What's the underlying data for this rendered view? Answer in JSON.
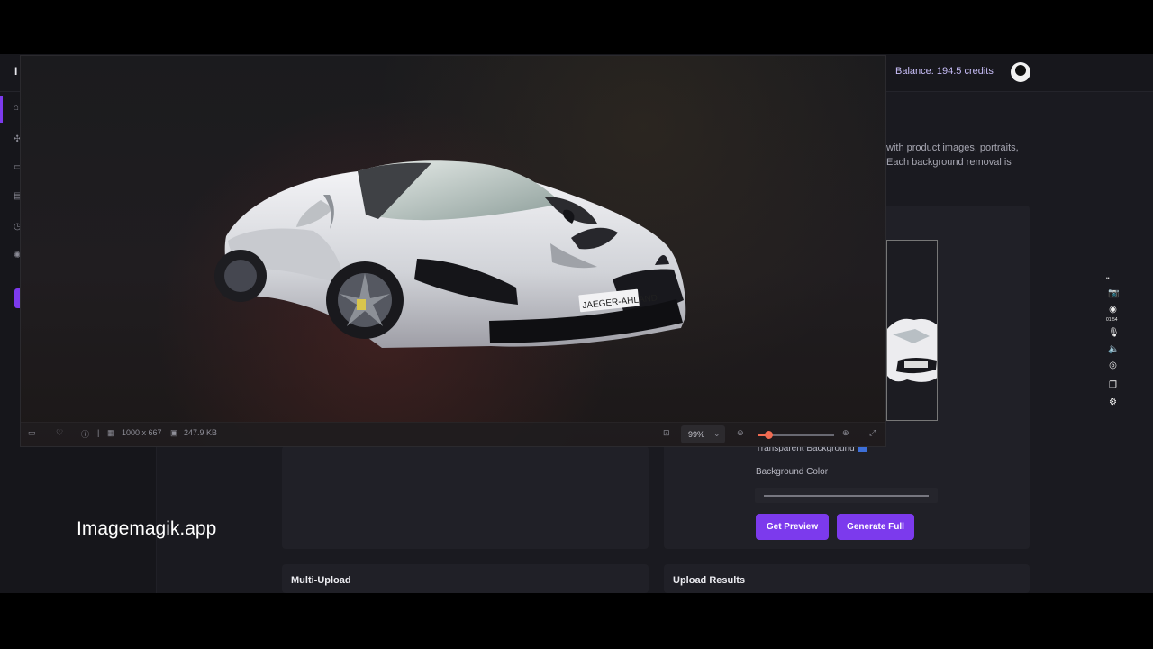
{
  "app": {
    "brand_fragment": "I",
    "balance": "Balance: 194.5 credits",
    "description_lines": [
      "with product images, portraits,",
      "Each background removal is"
    ]
  },
  "sidebar": {
    "icons": [
      "home-icon",
      "puzzle-icon",
      "monitor-icon",
      "bag-icon",
      "clock-icon",
      "settings-icon"
    ]
  },
  "options": {
    "transparent_background": "Transparent Background",
    "background_color": "Background Color",
    "get_preview": "Get Preview",
    "generate_full": "Generate Full"
  },
  "sections": {
    "multi_upload": "Multi-Upload",
    "upload_results": "Upload Results"
  },
  "viewer": {
    "dimensions": "1000 x 667",
    "file_size": "247.9 KB",
    "zoom": "99%",
    "zoom_slider_value": 0.1,
    "license_plate": "JAEGER-AHLAND"
  },
  "dock": {
    "timer": "01:54",
    "icons": [
      "camera-icon",
      "record-icon",
      "mic-icon",
      "speaker-icon",
      "webcam-icon",
      "window-icon",
      "gear-icon"
    ]
  },
  "watermark": "Imagemagik.app"
}
